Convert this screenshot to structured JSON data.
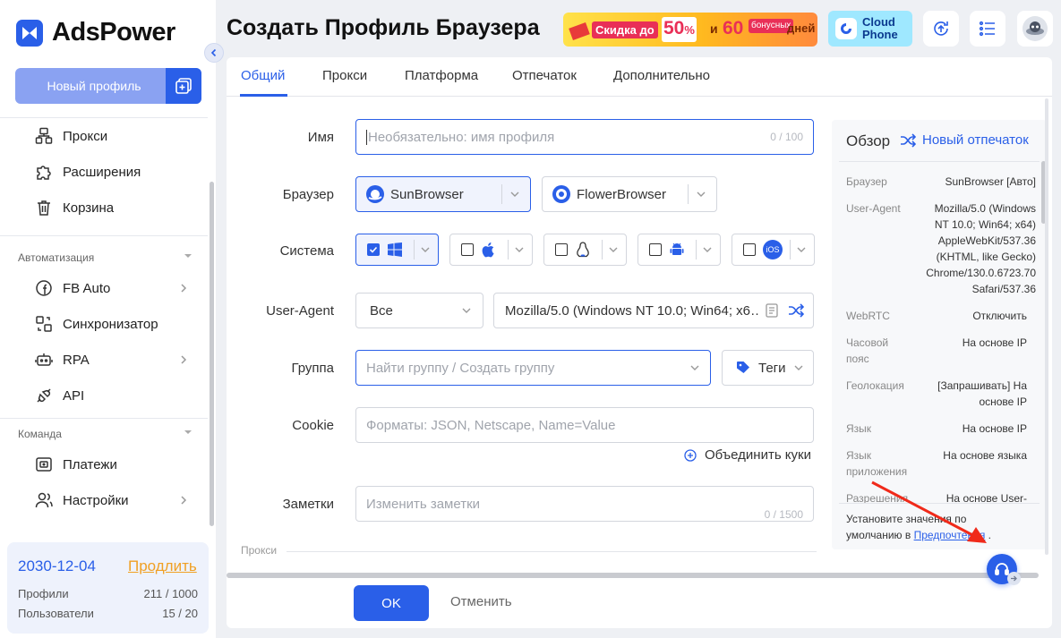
{
  "app": {
    "name": "AdsPower"
  },
  "sidebar": {
    "new_profile": "Новый профиль",
    "items_top": [
      {
        "label": "Прокси",
        "icon": "proxy-icon"
      },
      {
        "label": "Расширения",
        "icon": "extension-icon"
      },
      {
        "label": "Корзина",
        "icon": "trash-icon"
      }
    ],
    "section_automation": "Автоматизация",
    "items_automation": [
      {
        "label": "FB Auto",
        "icon": "facebook-icon"
      },
      {
        "label": "Синхронизатор",
        "icon": "sync-icon"
      },
      {
        "label": "RPA",
        "icon": "robot-icon"
      },
      {
        "label": "API",
        "icon": "api-icon"
      }
    ],
    "section_team": "Команда",
    "items_team": [
      {
        "label": "Платежи",
        "icon": "wallet-icon"
      },
      {
        "label": "Настройки",
        "icon": "users-settings-icon"
      }
    ],
    "subscription": {
      "date": "2030-12-04",
      "renew": "Продлить",
      "profiles_label": "Профили",
      "profiles_value": "211 / 1000",
      "users_label": "Пользователи",
      "users_value": "15 / 20"
    }
  },
  "header": {
    "title": "Создать Профиль Браузера",
    "banner": {
      "t1": "Скидка до",
      "t2": "50",
      "t3": "%",
      "t4": "и",
      "t5": "60",
      "t6": "бонусных",
      "t7": "дней"
    },
    "cloud_phone": {
      "line1": "Cloud",
      "line2": "Phone"
    }
  },
  "tabs": [
    "Общий",
    "Прокси",
    "Платформа",
    "Отпечаток",
    "Дополнительно"
  ],
  "form": {
    "name_label": "Имя",
    "name_placeholder": "Необязательно: имя профиля",
    "name_counter": "0 / 100",
    "browser_label": "Браузер",
    "browsers": [
      "SunBrowser",
      "FlowerBrowser"
    ],
    "system_label": "Система",
    "systems": [
      "windows-icon",
      "apple-icon",
      "linux-icon",
      "android-icon",
      "ios-icon"
    ],
    "ios_text": "iOS",
    "ua_label": "User-Agent",
    "ua_filter": "Все",
    "ua_value": "Mozilla/5.0 (Windows NT 10.0; Win64; x6…",
    "group_label": "Группа",
    "group_placeholder": "Найти группу / Создать группу",
    "tags": "Теги",
    "cookie_label": "Cookie",
    "cookie_placeholder": "Форматы: JSON, Netscape, Name=Value",
    "merge_cookies": "Объединить куки",
    "notes_label": "Заметки",
    "notes_placeholder": "Изменить заметки",
    "notes_counter": "0 / 1500",
    "next_section": "Прокси"
  },
  "overview": {
    "title": "Обзор",
    "new_fingerprint": "Новый отпечаток",
    "rows": [
      {
        "k": "Браузер",
        "v": "SunBrowser [Авто]"
      },
      {
        "k": "User-Agent",
        "v": "Mozilla/5.0 (Windows NT 10.0; Win64; x64) AppleWebKit/537.36 (KHTML, like Gecko) Chrome/130.0.6723.70 Safari/537.36"
      },
      {
        "k": "WebRTC",
        "v": "Отключить"
      },
      {
        "k": "Часовой пояс",
        "v": "На основе IP"
      },
      {
        "k": "Геолокация",
        "v": "[Запрашивать] На основе IP"
      },
      {
        "k": "Язык",
        "v": "На основе IP"
      },
      {
        "k": "Язык приложения",
        "v": "На основе языка"
      },
      {
        "k": "Разрешения",
        "v": "На основе User-"
      }
    ],
    "footer_text": "Установите значения по умолчанию в",
    "footer_link": "Предпочтения",
    "footer_end": "."
  },
  "actions": {
    "ok": "OK",
    "cancel": "Отменить"
  }
}
